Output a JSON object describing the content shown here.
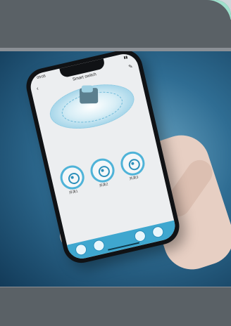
{
  "app": {
    "status_time": "09:05",
    "title": "Smart switch",
    "back_icon": "chevron-left-icon",
    "edit_icon": "pencil-icon"
  },
  "switches": [
    {
      "label": "开关1",
      "icon": "power-icon"
    },
    {
      "label": "开关2",
      "icon": "power-icon"
    },
    {
      "label": "开关3",
      "icon": "power-icon"
    }
  ],
  "tabbar": {
    "items": [
      {
        "icon": "on-icon"
      },
      {
        "icon": "off-icon"
      },
      {
        "icon": "timer-icon"
      },
      {
        "icon": "settings-icon"
      }
    ],
    "accent": "#3fa7cf"
  },
  "colors": {
    "mint_top": "#9fe0cc",
    "panel": "#5a6166",
    "scene_bg": "#2f6d93"
  }
}
